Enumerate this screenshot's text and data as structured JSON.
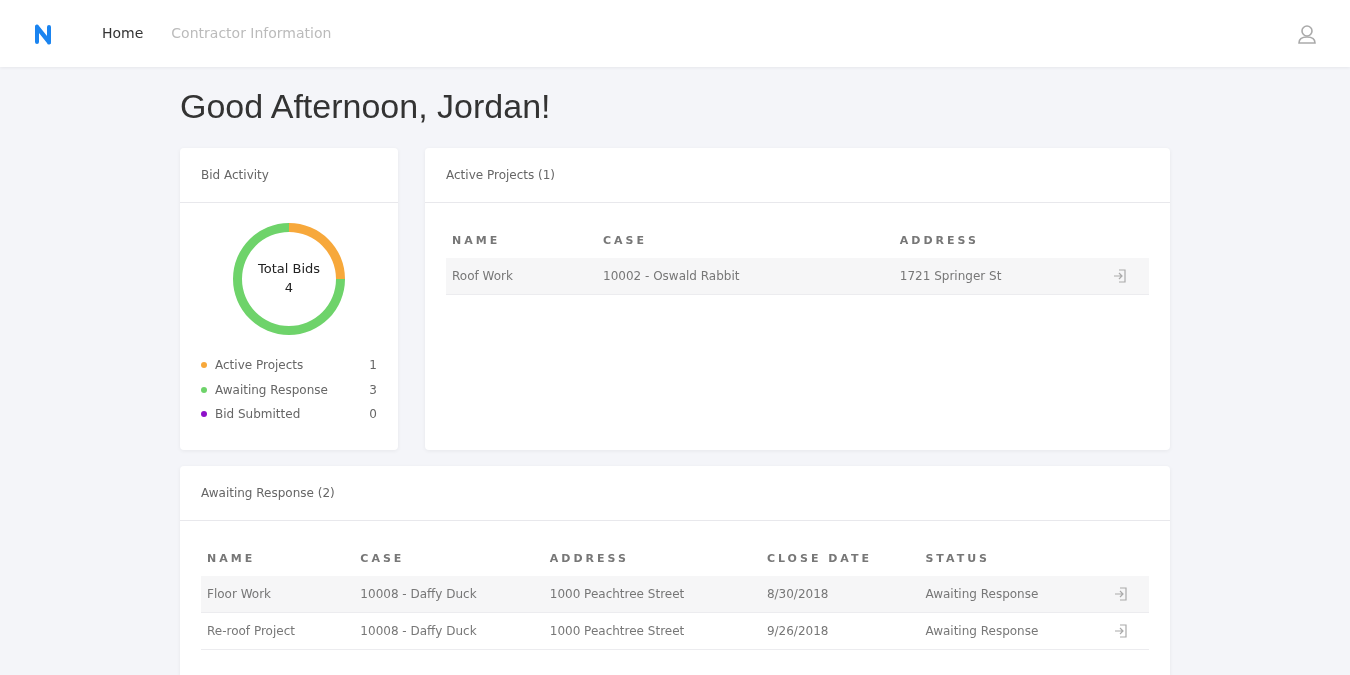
{
  "nav": {
    "items": [
      {
        "label": "Home",
        "selected": true
      },
      {
        "label": "Contractor Information",
        "selected": false
      }
    ]
  },
  "greeting": "Good Afternoon, Jordan!",
  "bid_activity": {
    "title": "Bid Activity",
    "center_label": "Total Bids",
    "center_value": "4",
    "chart_data": {
      "type": "donut",
      "categories": [
        "Active Projects",
        "Awaiting Response",
        "Bid Submitted"
      ],
      "values": [
        25,
        75,
        0
      ]
    },
    "legend": [
      {
        "count": "1",
        "color": "#f7a83b"
      },
      {
        "count": "3",
        "color": "#6ed36a"
      },
      {
        "count": "0",
        "color": "#8e10c9"
      }
    ]
  },
  "active_projects": {
    "title": "Active Projects (1)",
    "columns": [
      "NAME",
      "CASE",
      "ADDRESS"
    ],
    "rows": [
      [
        "Roof Work",
        "10002 - Oswald Rabbit",
        "1721 Springer St"
      ]
    ]
  },
  "awaiting_response": {
    "title": "Awaiting Response (2)",
    "columns": [
      "NAME",
      "CASE",
      "ADDRESS",
      "CLOSE DATE",
      "STATUS"
    ],
    "rows": [
      [
        "Floor Work",
        "10008 - Daffy Duck",
        "1000 Peachtree Street",
        "8/30/2018",
        "Awaiting Response"
      ],
      [
        "Re-roof Project",
        "10008 - Daffy Duck",
        "1000 Peachtree Street",
        "9/26/2018",
        "Awaiting Response"
      ]
    ]
  }
}
